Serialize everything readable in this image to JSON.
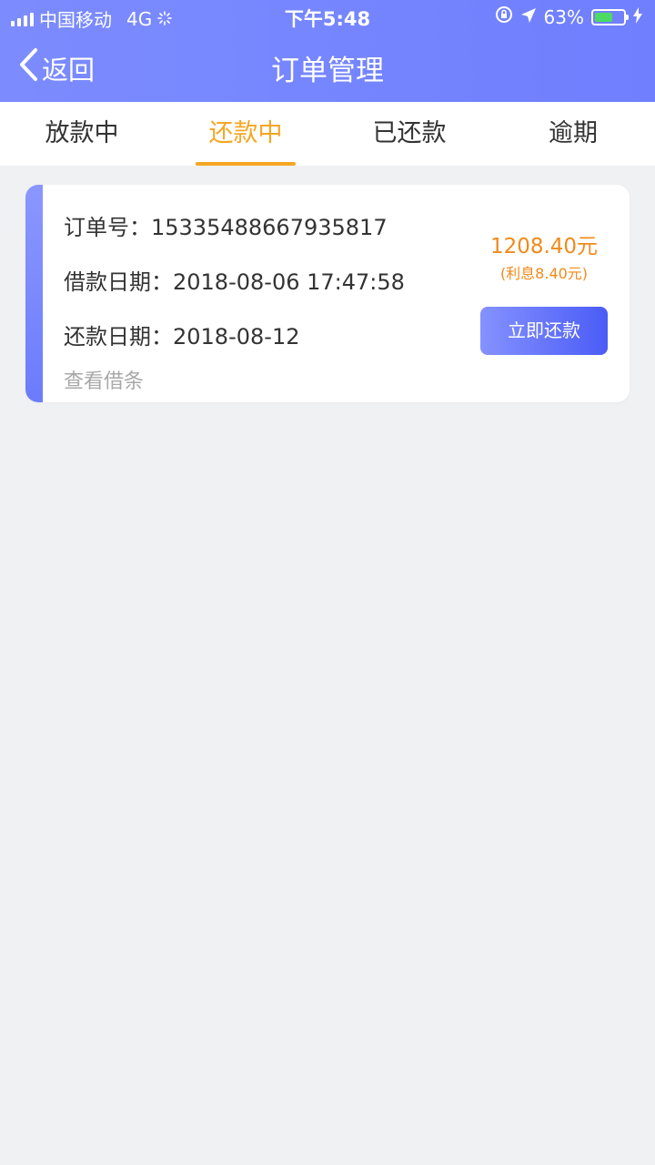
{
  "status_bar": {
    "carrier": "中国移动",
    "network": "4G",
    "time": "下午5:48",
    "battery": "63%",
    "battery_level": 0.63,
    "icons": [
      "signal-icon",
      "loading-icon",
      "rotation-lock-icon",
      "location-arrow-icon",
      "battery-icon",
      "charging-icon"
    ]
  },
  "nav": {
    "back_label": "返回",
    "title": "订单管理"
  },
  "tabs": [
    {
      "label": "放款中"
    },
    {
      "label": "还款中"
    },
    {
      "label": "已还款"
    },
    {
      "label": "逾期"
    }
  ],
  "active_tab": 1,
  "order": {
    "order_no_label": "订单号：",
    "order_no": "15335488667935817",
    "loan_date_label": "借款日期：",
    "loan_date": "2018-08-06 17:47:58",
    "repay_date_label": "还款日期：",
    "repay_date": "2018-08-12",
    "view_loan_note": "查看借条",
    "amount": "1208.40元",
    "interest": "(利息8.40元)",
    "repay_button": "立即还款"
  },
  "colors": {
    "header": "#7c8cfe",
    "accent": "#f5a623",
    "amount": "#f08a1a",
    "button": "#5f6ff9",
    "background": "#f0f1f3"
  }
}
